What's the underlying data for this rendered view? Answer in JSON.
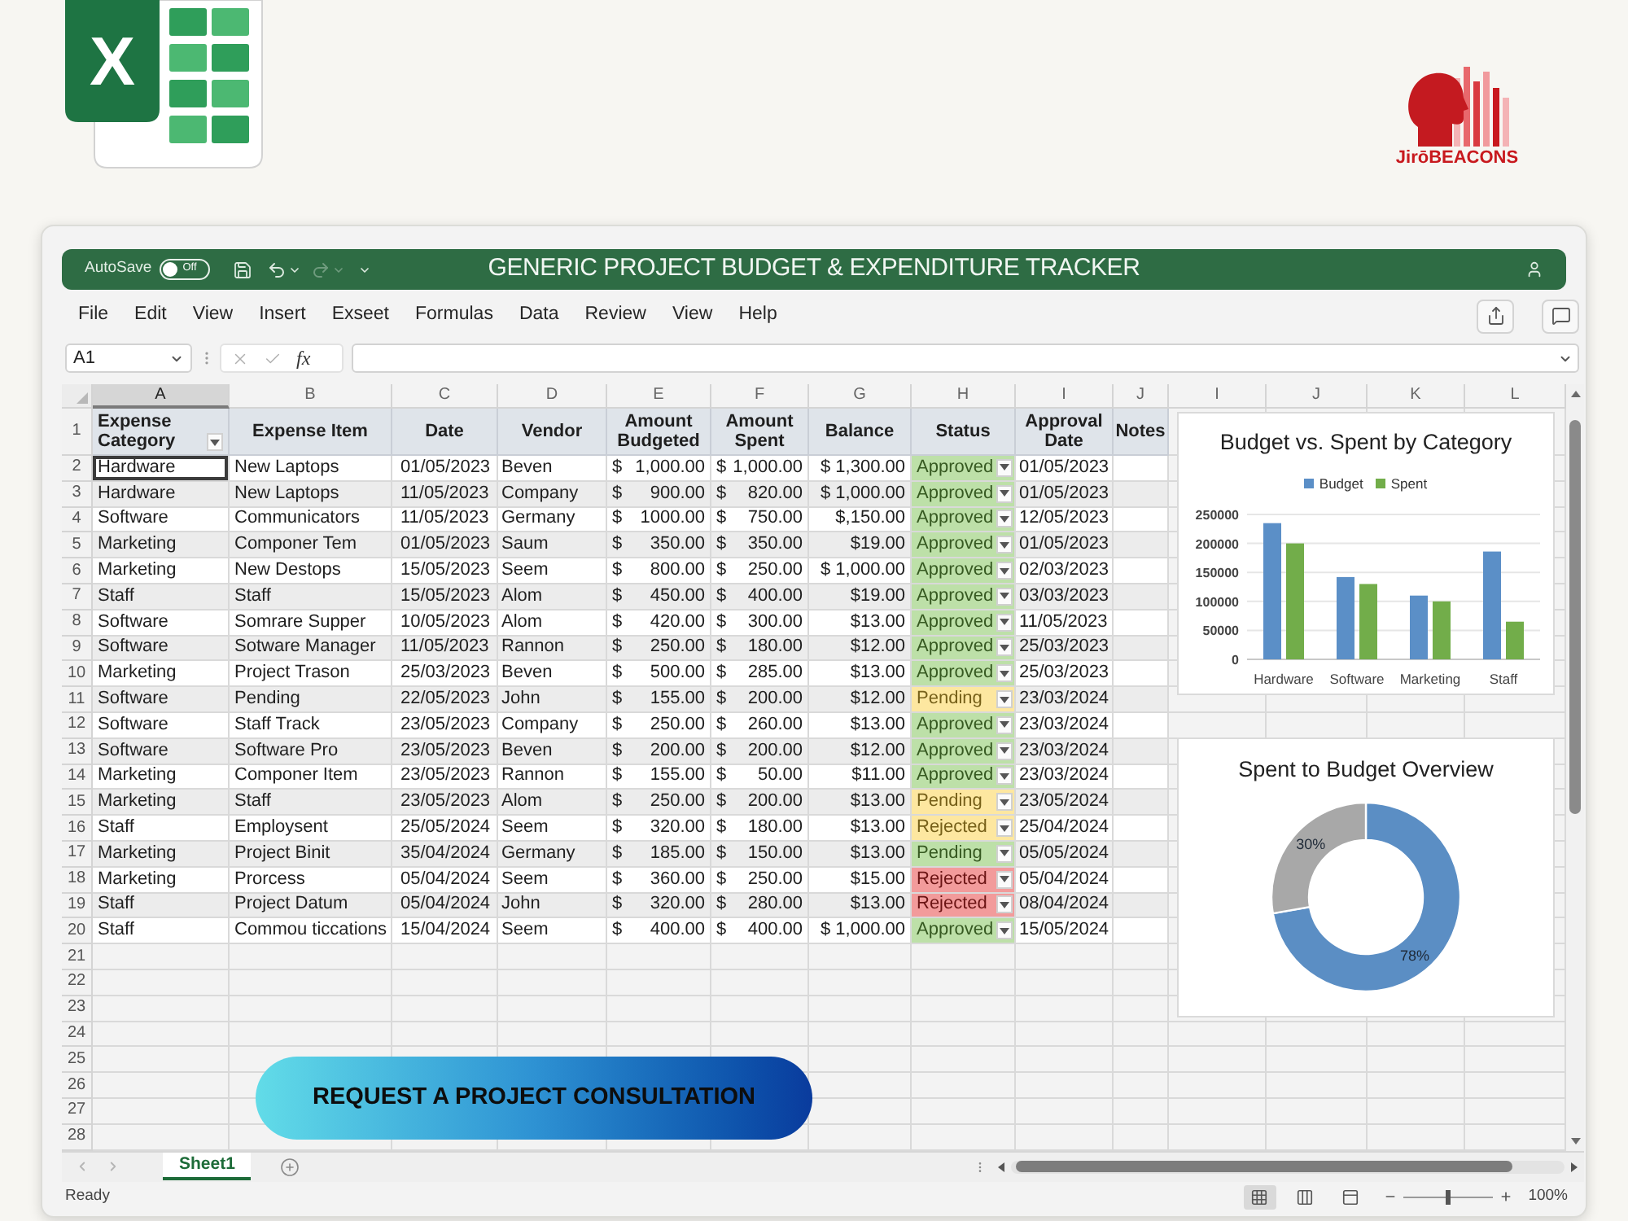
{
  "app_logo": {
    "letter": "X"
  },
  "brand_logo": {
    "text": "JirōBEACONS"
  },
  "title_bar": {
    "autosave_label": "AutoSave",
    "autosave_toggle": {
      "label": "Off",
      "on": false
    },
    "title": "GENERIC PROJECT BUDGET & EXPENDITURE TRACKER"
  },
  "menu": [
    "File",
    "Edit",
    "View",
    "Insert",
    "Exseet",
    "Formulas",
    "Data",
    "Review",
    "View",
    "Help"
  ],
  "formula_bar": {
    "name_box": "A1",
    "function_label": "fx"
  },
  "column_headers": [
    {
      "label": "A",
      "selected": true
    },
    {
      "label": "B",
      "selected": false
    },
    {
      "label": "C",
      "selected": false
    },
    {
      "label": "D",
      "selected": false
    },
    {
      "label": "E",
      "selected": false
    },
    {
      "label": "F",
      "selected": false
    },
    {
      "label": "G",
      "selected": false
    },
    {
      "label": "H",
      "selected": false
    },
    {
      "label": "I",
      "selected": false
    },
    {
      "label": "J",
      "selected": false
    },
    {
      "label": "I",
      "selected": false
    },
    {
      "label": "J",
      "selected": false
    },
    {
      "label": "K",
      "selected": false
    },
    {
      "label": "L",
      "selected": false
    }
  ],
  "table": {
    "header_row_number": "1",
    "columns": [
      "Expense Category",
      "Expense Item",
      "Date",
      "Vendor",
      "Amount Budgeted",
      "Amount Spent",
      "Balance",
      "Status",
      "Approval Date",
      "Notes"
    ],
    "rows": [
      {
        "number": "2",
        "category": {
          "text": "Hardware",
          "selected": true
        },
        "item": "New Laptops",
        "date": "01/05/2023",
        "vendor": "Beven",
        "budgeted": {
          "currency": "$",
          "amount": "1,000.00"
        },
        "spent": {
          "currency": "$",
          "amount": "1,000.00"
        },
        "balance": "$ 1,300.00",
        "status": {
          "label": "Approved",
          "color": "#bde0a8"
        },
        "approval_date": "01/05/2023"
      },
      {
        "number": "3",
        "category": {
          "text": "Hardware",
          "selected": false
        },
        "item": "New Laptops",
        "date": "11/05/2023",
        "vendor": "Company",
        "budgeted": {
          "currency": "$",
          "amount": "900.00"
        },
        "spent": {
          "currency": "$",
          "amount": "820.00"
        },
        "balance": "$ 1,000.00",
        "status": {
          "label": "Approved",
          "color": "#bde0a8"
        },
        "approval_date": "01/05/2023"
      },
      {
        "number": "4",
        "category": {
          "text": "Software",
          "selected": false
        },
        "item": "Communicators",
        "date": "11/05/2023",
        "vendor": "Germany",
        "budgeted": {
          "currency": "$",
          "amount": "1000.00"
        },
        "spent": {
          "currency": "$",
          "amount": "750.00"
        },
        "balance": "$,150.00",
        "status": {
          "label": "Approved",
          "color": "#bde0a8"
        },
        "approval_date": "12/05/2023"
      },
      {
        "number": "5",
        "category": {
          "text": "Marketing",
          "selected": false
        },
        "item": "Componer Tem",
        "date": "01/05/2023",
        "vendor": "Saum",
        "budgeted": {
          "currency": "$",
          "amount": "350.00"
        },
        "spent": {
          "currency": "$",
          "amount": "350.00"
        },
        "balance": "$19.00",
        "status": {
          "label": "Approved",
          "color": "#bde0a8"
        },
        "approval_date": "01/05/2023"
      },
      {
        "number": "6",
        "category": {
          "text": "Marketing",
          "selected": false
        },
        "item": "New Destops",
        "date": "15/05/2023",
        "vendor": "Seem",
        "budgeted": {
          "currency": "$",
          "amount": "800.00"
        },
        "spent": {
          "currency": "$",
          "amount": "250.00"
        },
        "balance": "$ 1,000.00",
        "status": {
          "label": "Approved",
          "color": "#bde0a8"
        },
        "approval_date": "02/03/2023"
      },
      {
        "number": "7",
        "category": {
          "text": "Staff",
          "selected": false
        },
        "item": "Staff",
        "date": "15/05/2023",
        "vendor": "Alom",
        "budgeted": {
          "currency": "$",
          "amount": "450.00"
        },
        "spent": {
          "currency": "$",
          "amount": "400.00"
        },
        "balance": "$19.00",
        "status": {
          "label": "Approved",
          "color": "#bde0a8"
        },
        "approval_date": "03/03/2023"
      },
      {
        "number": "8",
        "category": {
          "text": "Software",
          "selected": false
        },
        "item": "Somrare Supper",
        "date": "10/05/2023",
        "vendor": "Alom",
        "budgeted": {
          "currency": "$",
          "amount": "420.00"
        },
        "spent": {
          "currency": "$",
          "amount": "300.00"
        },
        "balance": "$13.00",
        "status": {
          "label": "Approved",
          "color": "#bde0a8"
        },
        "approval_date": "11/05/2023"
      },
      {
        "number": "9",
        "category": {
          "text": "Software",
          "selected": false
        },
        "item": "Sotware Manager",
        "date": "11/05/2023",
        "vendor": "Rannon",
        "budgeted": {
          "currency": "$",
          "amount": "250.00"
        },
        "spent": {
          "currency": "$",
          "amount": "180.00"
        },
        "balance": "$12.00",
        "status": {
          "label": "Approved",
          "color": "#bde0a8"
        },
        "approval_date": "25/03/2023"
      },
      {
        "number": "10",
        "category": {
          "text": "Marketing",
          "selected": false
        },
        "item": "Project Trason",
        "date": "25/03/2023",
        "vendor": "Beven",
        "budgeted": {
          "currency": "$",
          "amount": "500.00"
        },
        "spent": {
          "currency": "$",
          "amount": "285.00"
        },
        "balance": "$13.00",
        "status": {
          "label": "Approved",
          "color": "#bde0a8"
        },
        "approval_date": "25/03/2023"
      },
      {
        "number": "11",
        "category": {
          "text": "Software",
          "selected": false
        },
        "item": "Pending",
        "date": "22/05/2023",
        "vendor": "John",
        "budgeted": {
          "currency": "$",
          "amount": "155.00"
        },
        "spent": {
          "currency": "$",
          "amount": "200.00"
        },
        "balance": "$12.00",
        "status": {
          "label": "Pending",
          "color": "#fde7a0"
        },
        "approval_date": "23/03/2024"
      },
      {
        "number": "12",
        "category": {
          "text": "Software",
          "selected": false
        },
        "item": "Staff Track",
        "date": "23/05/2023",
        "vendor": "Company",
        "budgeted": {
          "currency": "$",
          "amount": "250.00"
        },
        "spent": {
          "currency": "$",
          "amount": "260.00"
        },
        "balance": "$13.00",
        "status": {
          "label": "Approved",
          "color": "#bde0a8"
        },
        "approval_date": "23/03/2024"
      },
      {
        "number": "13",
        "category": {
          "text": "Software",
          "selected": false
        },
        "item": "Software Pro",
        "date": "23/05/2023",
        "vendor": "Beven",
        "budgeted": {
          "currency": "$",
          "amount": "200.00"
        },
        "spent": {
          "currency": "$",
          "amount": "200.00"
        },
        "balance": "$12.00",
        "status": {
          "label": "Approved",
          "color": "#bde0a8"
        },
        "approval_date": "23/03/2024"
      },
      {
        "number": "14",
        "category": {
          "text": "Marketing",
          "selected": false
        },
        "item": "Componer Item",
        "date": "23/05/2023",
        "vendor": "Rannon",
        "budgeted": {
          "currency": "$",
          "amount": "155.00"
        },
        "spent": {
          "currency": "$",
          "amount": "50.00"
        },
        "balance": "$11.00",
        "status": {
          "label": "Approved",
          "color": "#bde0a8"
        },
        "approval_date": "23/03/2024"
      },
      {
        "number": "15",
        "category": {
          "text": "Marketing",
          "selected": false
        },
        "item": "Staff",
        "date": "23/05/2023",
        "vendor": "Alom",
        "budgeted": {
          "currency": "$",
          "amount": "250.00"
        },
        "spent": {
          "currency": "$",
          "amount": "200.00"
        },
        "balance": "$13.00",
        "status": {
          "label": "Pending",
          "color": "#fde7a0"
        },
        "approval_date": "23/05/2024"
      },
      {
        "number": "16",
        "category": {
          "text": "Staff",
          "selected": false
        },
        "item": "Employsent",
        "date": "25/05/2024",
        "vendor": "Seem",
        "budgeted": {
          "currency": "$",
          "amount": "320.00"
        },
        "spent": {
          "currency": "$",
          "amount": "180.00"
        },
        "balance": "$13.00",
        "status": {
          "label": "Rejected",
          "color": "#fde7a0"
        },
        "approval_date": "25/04/2024"
      },
      {
        "number": "17",
        "category": {
          "text": "Marketing",
          "selected": false
        },
        "item": "Project Binit",
        "date": "35/04/2024",
        "vendor": "Germany",
        "budgeted": {
          "currency": "$",
          "amount": "185.00"
        },
        "spent": {
          "currency": "$",
          "amount": "150.00"
        },
        "balance": "$13.00",
        "status": {
          "label": "Pending",
          "color": "#bde0a8"
        },
        "approval_date": "05/05/2024"
      },
      {
        "number": "18",
        "category": {
          "text": "Marketing",
          "selected": false
        },
        "item": "Prorcess",
        "date": "05/04/2024",
        "vendor": "Seem",
        "budgeted": {
          "currency": "$",
          "amount": "360.00"
        },
        "spent": {
          "currency": "$",
          "amount": "250.00"
        },
        "balance": "$15.00",
        "status": {
          "label": "Rejected",
          "color": "#f29b9b"
        },
        "approval_date": "05/04/2024"
      },
      {
        "number": "19",
        "category": {
          "text": "Staff",
          "selected": false
        },
        "item": "Project Datum",
        "date": "05/04/2024",
        "vendor": "John",
        "budgeted": {
          "currency": "$",
          "amount": "320.00"
        },
        "spent": {
          "currency": "$",
          "amount": "280.00"
        },
        "balance": "$13.00",
        "status": {
          "label": "Rejected",
          "color": "#f29b9b"
        },
        "approval_date": "08/04/2024"
      },
      {
        "number": "20",
        "category": {
          "text": "Staff",
          "selected": false
        },
        "item": "Commou ticcations",
        "date": "15/04/2024",
        "vendor": "Seem",
        "budgeted": {
          "currency": "$",
          "amount": "400.00"
        },
        "spent": {
          "currency": "$",
          "amount": "400.00"
        },
        "balance": "$ 1,000.00",
        "status": {
          "label": "Approved",
          "color": "#bde0a8"
        },
        "approval_date": "15/05/2024"
      }
    ],
    "empty_rows": [
      "21",
      "22",
      "23",
      "24",
      "25",
      "26",
      "27",
      "28"
    ]
  },
  "charts": [
    {
      "chart_data": {
        "type": "bar",
        "title": "Budget vs. Spent by Category",
        "legend": "top",
        "grid": true,
        "categories": [
          "Hardware",
          "Software",
          "Marketing",
          "Staff"
        ],
        "series": [
          {
            "name": "Budget",
            "color": "#5b8fc7",
            "values": [
              235000,
              142000,
              110000,
              186000
            ]
          },
          {
            "name": "Spent",
            "color": "#72ad4a",
            "values": [
              200000,
              130000,
              100000,
              65000
            ]
          }
        ],
        "ylim": [
          0,
          250000
        ],
        "yticks": [
          0,
          50000,
          100000,
          150000,
          200000,
          250000
        ]
      }
    },
    {
      "chart_data": {
        "type": "donut",
        "title": "Spent to Budget Overview",
        "values": [
          78,
          30
        ],
        "colors": [
          "#5b8ec4",
          "#a8a8a8"
        ],
        "value_labels": [
          "78%",
          "30%"
        ]
      }
    }
  ],
  "cta_button": "REQUEST A PROJECT CONSULTATION",
  "sheet_tabs": [
    {
      "label": "Sheet1",
      "selected": true
    }
  ],
  "status_bar": {
    "status": "Ready",
    "views": [
      {
        "kind": "normal",
        "selected": true
      },
      {
        "kind": "page_break",
        "selected": false
      },
      {
        "kind": "page_layout",
        "selected": false
      }
    ],
    "zoom": {
      "level": 0.5
    },
    "zoom_label": "100%"
  }
}
